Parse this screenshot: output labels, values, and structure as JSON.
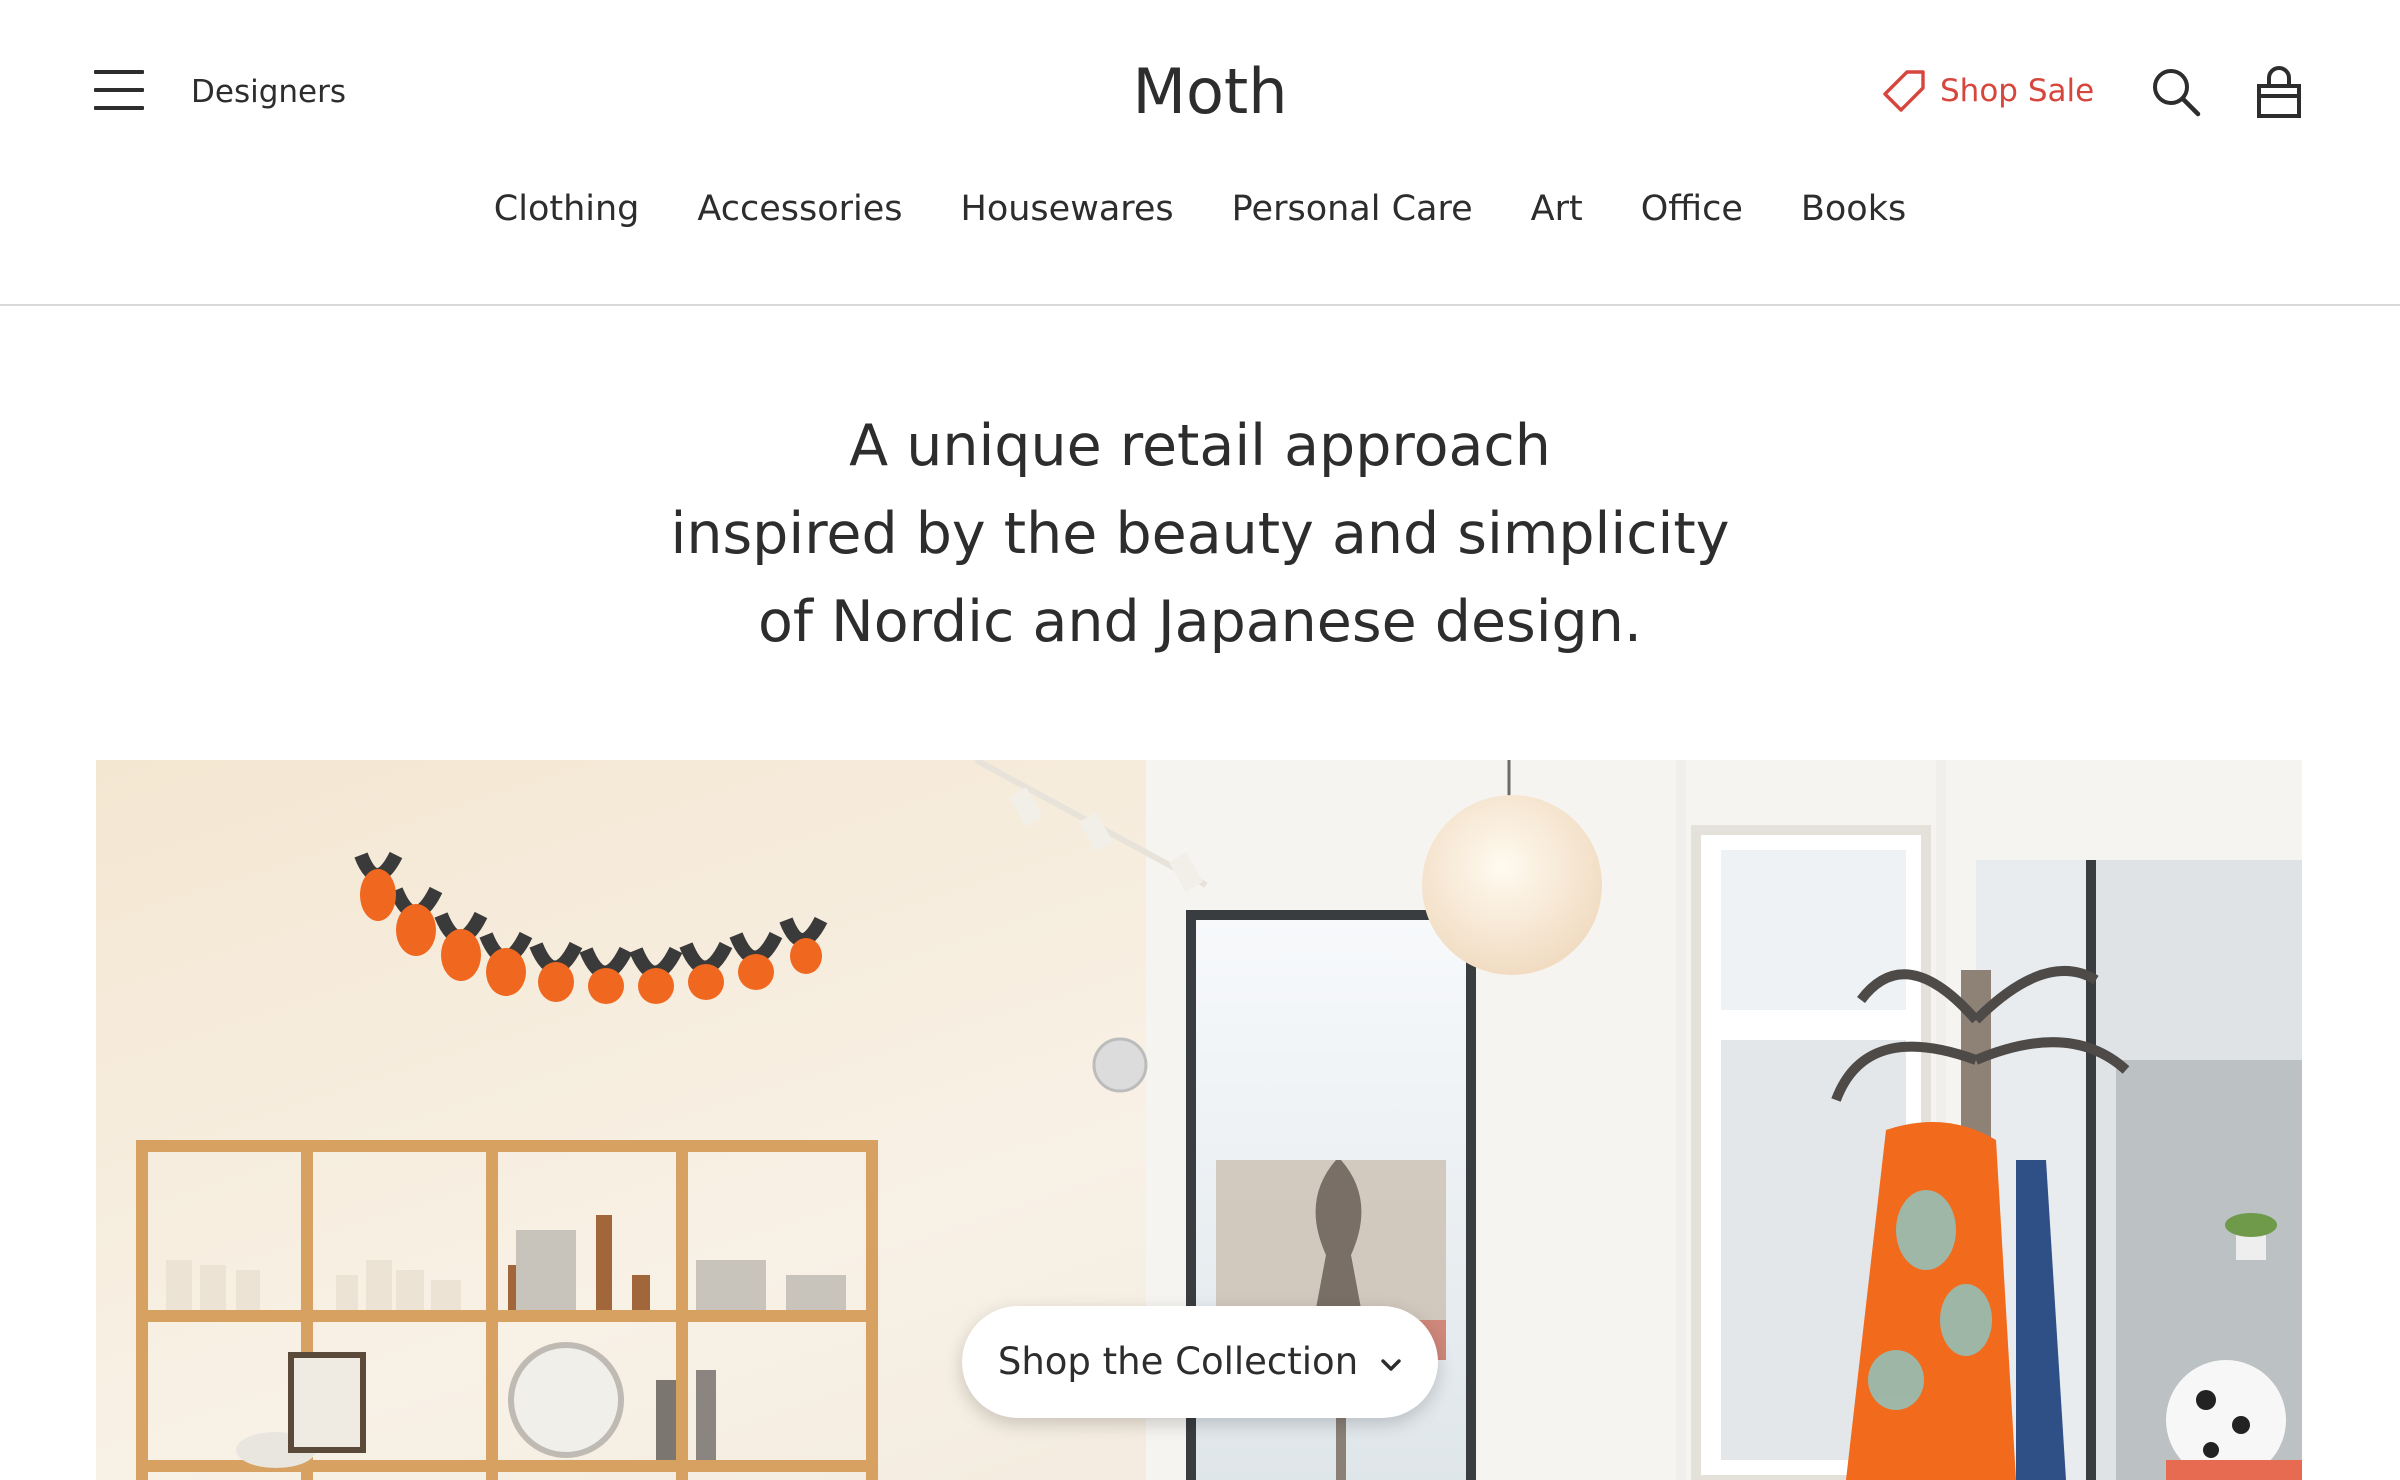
{
  "header": {
    "menu_icon": "hamburger-menu-icon",
    "designers_label": "Designers",
    "logo": "Moth",
    "sale_icon": "price-tag-icon",
    "sale_label": "Shop Sale",
    "search_icon": "search-icon",
    "cart_icon": "shopping-bag-icon"
  },
  "nav": {
    "items": [
      "Clothing",
      "Accessories",
      "Housewares",
      "Personal Care",
      "Art",
      "Office",
      "Books"
    ]
  },
  "intro": {
    "lines": [
      "A unique retail approach",
      "inspired by the beauty and simplicity",
      "of Nordic and Japanese design."
    ]
  },
  "hero": {
    "image": "store-interior-photo",
    "cta_label": "Shop the Collection",
    "cta_icon": "chevron-down-icon"
  },
  "colors": {
    "text": "#2d2d2d",
    "sale_accent": "#d6463d",
    "divider": "#d9d9d9",
    "background": "#ffffff"
  }
}
